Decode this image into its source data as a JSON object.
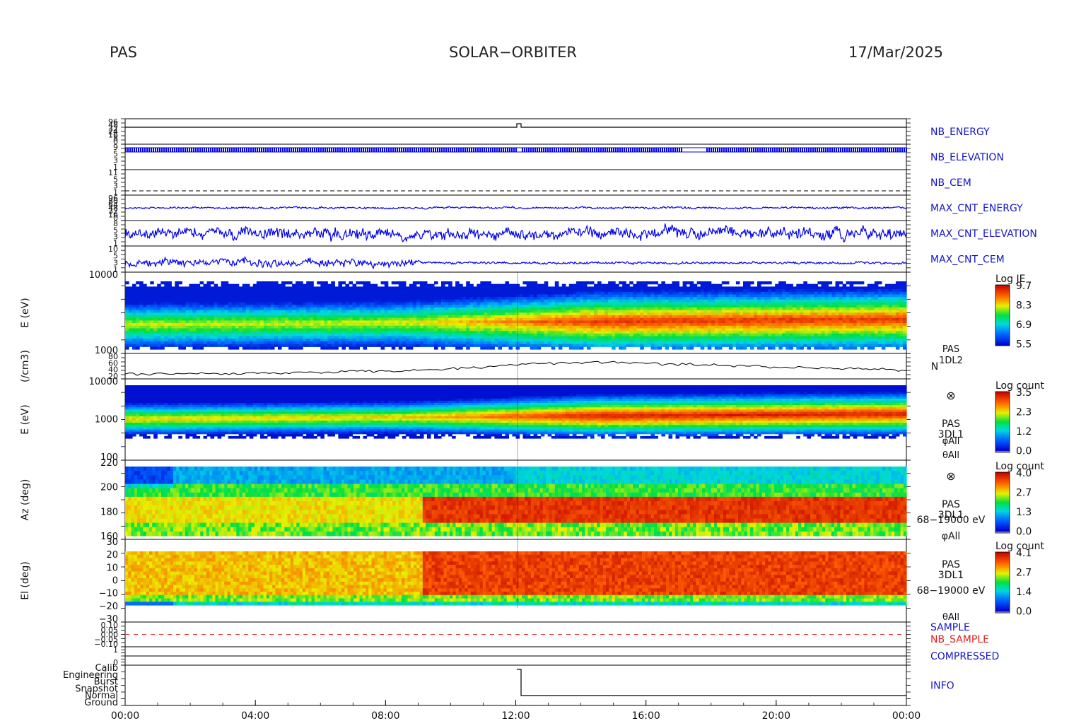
{
  "header": {
    "left": "PAS",
    "center": "SOLAR−ORBITER",
    "right": "17/Mar/2025"
  },
  "colors": {
    "trace_blue": "#0000ee",
    "label_blue": "#1515c8",
    "label_red": "#e02020",
    "sample_red": "#e83030"
  },
  "chart_data": [
    {
      "type": "line",
      "panel": "nb_energy",
      "series_name": "NB_ENERGY",
      "y_ticks": [
        "96",
        "48",
        "32",
        "24",
        "16",
        "8",
        "0"
      ]
    },
    {
      "type": "line",
      "panel": "nb_elevation",
      "series_name": "NB_ELEVATION",
      "y_ticks": [
        "9",
        "5",
        "3",
        "1"
      ]
    },
    {
      "type": "line",
      "panel": "nb_cem",
      "series_name": "NB_CEM",
      "y_ticks": [
        "11",
        "5",
        "3",
        "1"
      ]
    },
    {
      "type": "line",
      "panel": "max_cnt_energy",
      "series_name": "MAX_CNT_ENERGY",
      "y_ticks": [
        "96",
        "80",
        "64",
        "48",
        "32",
        "16",
        "0"
      ]
    },
    {
      "type": "line",
      "panel": "max_cnt_elevation",
      "series_name": "MAX_CNT_ELEVATION",
      "y_ticks": [
        "8",
        "5",
        "3",
        "1"
      ]
    },
    {
      "type": "line",
      "panel": "max_cnt_cem",
      "series_name": "MAX_CNT_CEM",
      "y_ticks": [
        "10",
        "5",
        "3",
        "1"
      ]
    },
    {
      "type": "heatmap",
      "panel": "energy_je",
      "ylabel": "E (eV)",
      "y_ticks": [
        "10000",
        "1000"
      ],
      "yscale": "log",
      "colorbar": {
        "title": "Log JE",
        "ticks": [
          "9.7",
          "8.3",
          "6.9",
          "5.5"
        ]
      }
    },
    {
      "type": "line",
      "panel": "density",
      "ylabel": "(/cm3)",
      "y_ticks": [
        "80",
        "60",
        "40",
        "20"
      ],
      "side_labels": [
        "PAS",
        "1DL2",
        "N"
      ],
      "y": [
        26,
        26,
        27,
        27,
        28,
        28,
        29,
        30,
        30,
        31,
        32,
        33,
        34,
        35,
        37,
        39,
        41,
        44,
        47,
        52,
        56,
        58,
        60,
        62,
        61,
        60,
        58,
        56,
        55,
        54,
        52,
        50,
        48,
        47,
        45,
        44,
        43,
        42,
        40,
        36
      ]
    },
    {
      "type": "heatmap",
      "panel": "energy_counts",
      "ylabel": "E (eV)",
      "y_ticks": [
        "10000",
        "1000",
        "100"
      ],
      "yscale": "log",
      "side_labels": [
        "⊗",
        "PAS",
        "3DL1",
        "φAll",
        "θAll"
      ],
      "colorbar": {
        "title": "Log count",
        "ticks": [
          "3.5",
          "2.3",
          "1.2",
          "0.0"
        ]
      }
    },
    {
      "type": "heatmap",
      "panel": "azimuth",
      "ylabel": "Az (deg)",
      "y_ticks": [
        "220",
        "200",
        "180",
        "160"
      ],
      "side_labels": [
        "⊗",
        "PAS",
        "3DL1",
        "68−19000 eV",
        "φAll"
      ],
      "colorbar": {
        "title": "Log count",
        "ticks": [
          "4.0",
          "2.7",
          "1.3",
          "0.0"
        ]
      }
    },
    {
      "type": "heatmap",
      "panel": "elevation",
      "ylabel": "El (deg)",
      "y_ticks": [
        "30",
        "20",
        "10",
        "0",
        "−10",
        "−20",
        "−30"
      ],
      "side_labels": [
        "PAS",
        "3DL1",
        "68−19000 eV",
        "θAll"
      ],
      "colorbar": {
        "title": "Log count",
        "ticks": [
          "4.1",
          "2.7",
          "1.4",
          "0.0"
        ]
      }
    },
    {
      "type": "line",
      "panel": "sample",
      "y_ticks": [
        "0.10",
        "0.05",
        "0.00",
        "−0.05",
        "−0.10"
      ],
      "series": [
        {
          "name": "SAMPLE"
        },
        {
          "name": "NB_SAMPLE"
        }
      ]
    },
    {
      "type": "line",
      "panel": "compressed",
      "series_name": "COMPRESSED",
      "y_ticks": [
        "1",
        "0"
      ]
    },
    {
      "type": "line",
      "panel": "info",
      "series_name": "INFO",
      "y_ticks": [
        "Calib",
        "Engineering",
        "Burst",
        "Snapshot",
        "Normal",
        "Ground"
      ]
    }
  ],
  "x_axis": {
    "tick_labels": [
      "00:00",
      "04:00",
      "08:00",
      "12:00",
      "16:00",
      "20:00",
      "00:00"
    ]
  }
}
